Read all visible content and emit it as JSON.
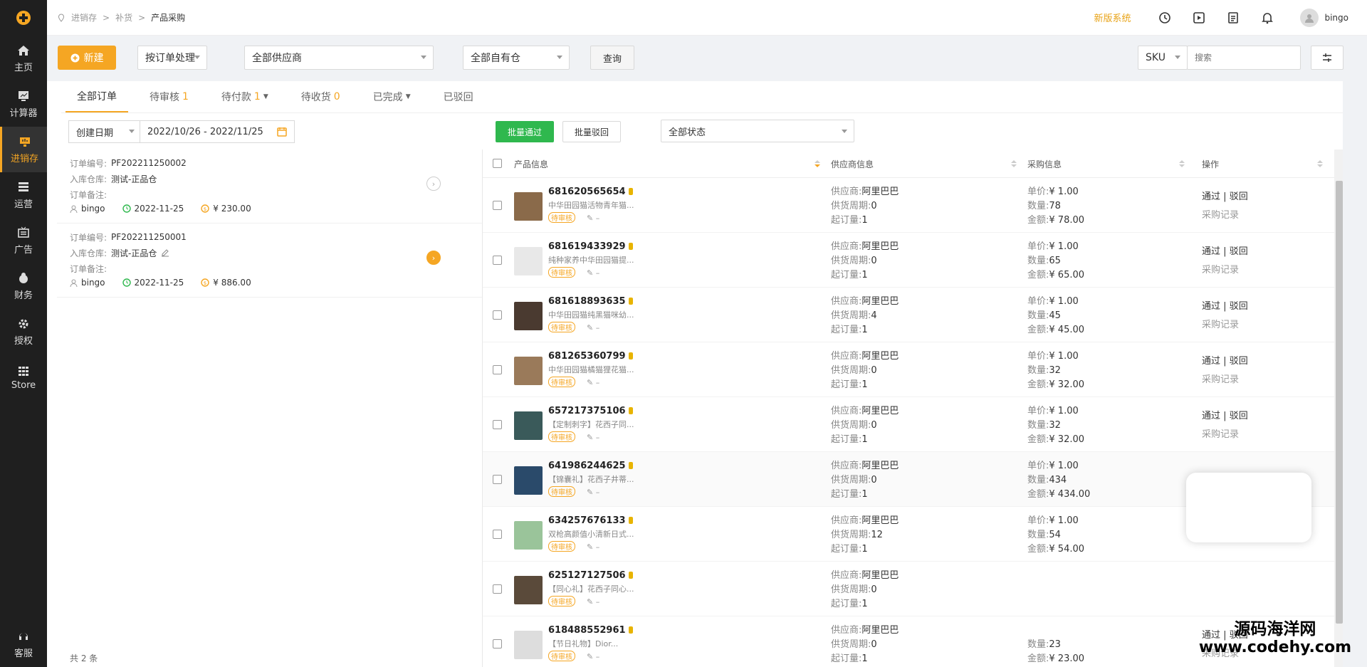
{
  "sidebar": {
    "items": [
      {
        "label": "主页",
        "icon": "home-icon"
      },
      {
        "label": "计算器",
        "icon": "calculator-icon"
      },
      {
        "label": "进销存",
        "icon": "inventory-icon"
      },
      {
        "label": "运营",
        "icon": "operations-icon"
      },
      {
        "label": "广告",
        "icon": "ads-icon"
      },
      {
        "label": "财务",
        "icon": "finance-icon"
      },
      {
        "label": "授权",
        "icon": "gear-icon"
      },
      {
        "label": "Store",
        "icon": "grid-icon"
      }
    ],
    "active_index": 2,
    "bottom": {
      "label": "客服",
      "icon": "headset-icon"
    }
  },
  "header": {
    "breadcrumb": [
      "进销存",
      "补货",
      "产品采购"
    ],
    "new_version": "新版系统",
    "user": "bingo",
    "accent": "#f5a623"
  },
  "filters": {
    "new_button": "新建",
    "mode": "按订单处理",
    "supplier": "全部供应商",
    "warehouse": "全部自有仓",
    "query_button": "查询",
    "sku_type": "SKU",
    "search_placeholder": "搜索"
  },
  "tabs": [
    {
      "label": "全部订单",
      "count": ""
    },
    {
      "label": "待审核",
      "count": "1"
    },
    {
      "label": "待付款",
      "count": "1"
    },
    {
      "label": "待收货",
      "count": "0"
    },
    {
      "label": "已完成",
      "count": ""
    },
    {
      "label": "已驳回",
      "count": ""
    }
  ],
  "date_filter": {
    "type": "创建日期",
    "range": "2022/10/26 - 2022/11/25"
  },
  "batch": {
    "approve": "批量通过",
    "reject": "批量驳回",
    "status": "全部状态"
  },
  "orders": [
    {
      "no_label": "订单编号:",
      "no": "PF202211250002",
      "wh_label": "入库仓库:",
      "wh": "测试-正品仓",
      "note_label": "订单备注:",
      "user": "bingo",
      "date": "2022-11-25",
      "amount": "¥ 230.00"
    },
    {
      "no_label": "订单编号:",
      "no": "PF202211250001",
      "wh_label": "入库仓库:",
      "wh": "测试-正品仓",
      "note_label": "订单备注:",
      "user": "bingo",
      "date": "2022-11-25",
      "amount": "¥ 886.00"
    }
  ],
  "total": "共 2 条",
  "table": {
    "headers": [
      "产品信息",
      "供应商信息",
      "采购信息",
      "操作"
    ],
    "rows": [
      {
        "id": "681620565654",
        "name": "中华田园猫活物青年猫...",
        "status": "待审核",
        "supplier": "阿里巴巴",
        "period": "0",
        "moq": "1",
        "price": "¥ 1.00",
        "qty": "78",
        "amount": "¥ 78.00",
        "thumb": "#8a6a4a"
      },
      {
        "id": "681619433929",
        "name": "纯种家养中华田园猫提...",
        "status": "待审核",
        "supplier": "阿里巴巴",
        "period": "0",
        "moq": "1",
        "price": "¥ 1.00",
        "qty": "65",
        "amount": "¥ 65.00",
        "thumb": "#e8e8e8"
      },
      {
        "id": "681618893635",
        "name": "中华田园猫纯黑猫咪幼...",
        "status": "待审核",
        "supplier": "阿里巴巴",
        "period": "4",
        "moq": "1",
        "price": "¥ 1.00",
        "qty": "45",
        "amount": "¥ 45.00",
        "thumb": "#4a3a30"
      },
      {
        "id": "681265360799",
        "name": "中华田园猫橘猫狸花猫...",
        "status": "待审核",
        "supplier": "阿里巴巴",
        "period": "0",
        "moq": "1",
        "price": "¥ 1.00",
        "qty": "32",
        "amount": "¥ 32.00",
        "thumb": "#9a7a5a"
      },
      {
        "id": "657217375106",
        "name": "【定制刺字】花西子同...",
        "status": "待审核",
        "supplier": "阿里巴巴",
        "period": "0",
        "moq": "1",
        "price": "¥ 1.00",
        "qty": "32",
        "amount": "¥ 32.00",
        "thumb": "#3a5a5a"
      },
      {
        "id": "641986244625",
        "name": "【锦囊礼】花西子井蒂...",
        "status": "待审核",
        "supplier": "阿里巴巴",
        "period": "0",
        "moq": "1",
        "price": "¥ 1.00",
        "qty": "434",
        "amount": "¥ 434.00",
        "thumb": "#2a4a6a"
      },
      {
        "id": "634257676133",
        "name": "双枪高颜值小清新日式...",
        "status": "待审核",
        "supplier": "阿里巴巴",
        "period": "12",
        "moq": "1",
        "price": "¥ 1.00",
        "qty": "54",
        "amount": "¥ 54.00",
        "thumb": "#9ac49a"
      },
      {
        "id": "625127127506",
        "name": "【同心礼】花西子同心...",
        "status": "待审核",
        "supplier": "阿里巴巴",
        "period": "0",
        "moq": "1",
        "price": "",
        "qty": "",
        "amount": "",
        "thumb": "#5a4a3a"
      },
      {
        "id": "618488552961",
        "name": "【节日礼物】Dior...",
        "status": "待审核",
        "supplier": "阿里巴巴",
        "period": "0",
        "moq": "1",
        "price": "",
        "qty": "23",
        "amount": "¥ 23.00",
        "thumb": "#ddd"
      }
    ],
    "labels": {
      "supplier": "供应商:",
      "period": "供货周期:",
      "moq": "起订量:",
      "price": "单价:",
      "qty": "数量:",
      "amount": "金额:"
    },
    "ops": {
      "approve": "通过",
      "sep": "|",
      "reject": "驳回",
      "records": "采购记录"
    }
  },
  "watermark": {
    "line1": "源码海洋网",
    "line2": "www.codehy.com"
  }
}
